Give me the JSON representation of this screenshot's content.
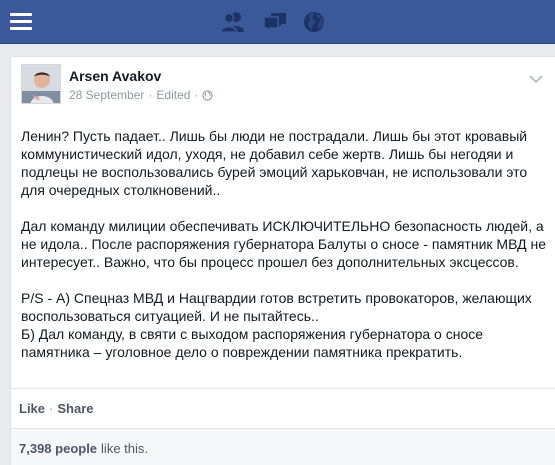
{
  "colors": {
    "topbar": "#3b5998",
    "page_bg": "#e9eaed",
    "text": "#141823",
    "muted": "#9197a3",
    "action": "#4e5665"
  },
  "topbar": {
    "menu_icon": "hamburger-menu-icon",
    "jewels": [
      "friends-icon",
      "messages-icon",
      "globe-icon"
    ]
  },
  "post": {
    "author": "Arsen Avakov",
    "date": "28 September",
    "edited": "Edited",
    "separator": "·",
    "privacy_icon": "public-globe-icon",
    "menu_icon": "chevron-down-icon",
    "paragraphs": [
      "Ленин? Пусть падает.. Лишь бы люди не пострадали. Лишь бы этот кровавый коммунистический идол, уходя, не добавил себе жертв. Лишь бы негодяи и подлецы не воспользовались бурей эмоций харьковчан, не использовали это для очередных столкновений..",
      "Дал команду милиции обеспечивать ИСКЛЮЧИТЕЛЬНО безопасность людей, а не идола.. После распоряжения губернатора Балуты о сносе - памятник МВД не интересует.. Важно, что бы процесс прошел без дополнительных эксцессов.",
      "P/S - А) Спецназ МВД и Нацгвардии готов встретить провокаторов, желающих воспользоваться ситуацией. И не пытайтесь..\nБ) Дал команду, в святи с выходом распоряжения губернатора о сносе памятника – уголовное дело о повреждении памятника прекратить."
    ]
  },
  "actions": {
    "like": "Like",
    "separator": "·",
    "share": "Share"
  },
  "likes": {
    "count": "7,398 people",
    "text": "like this."
  }
}
